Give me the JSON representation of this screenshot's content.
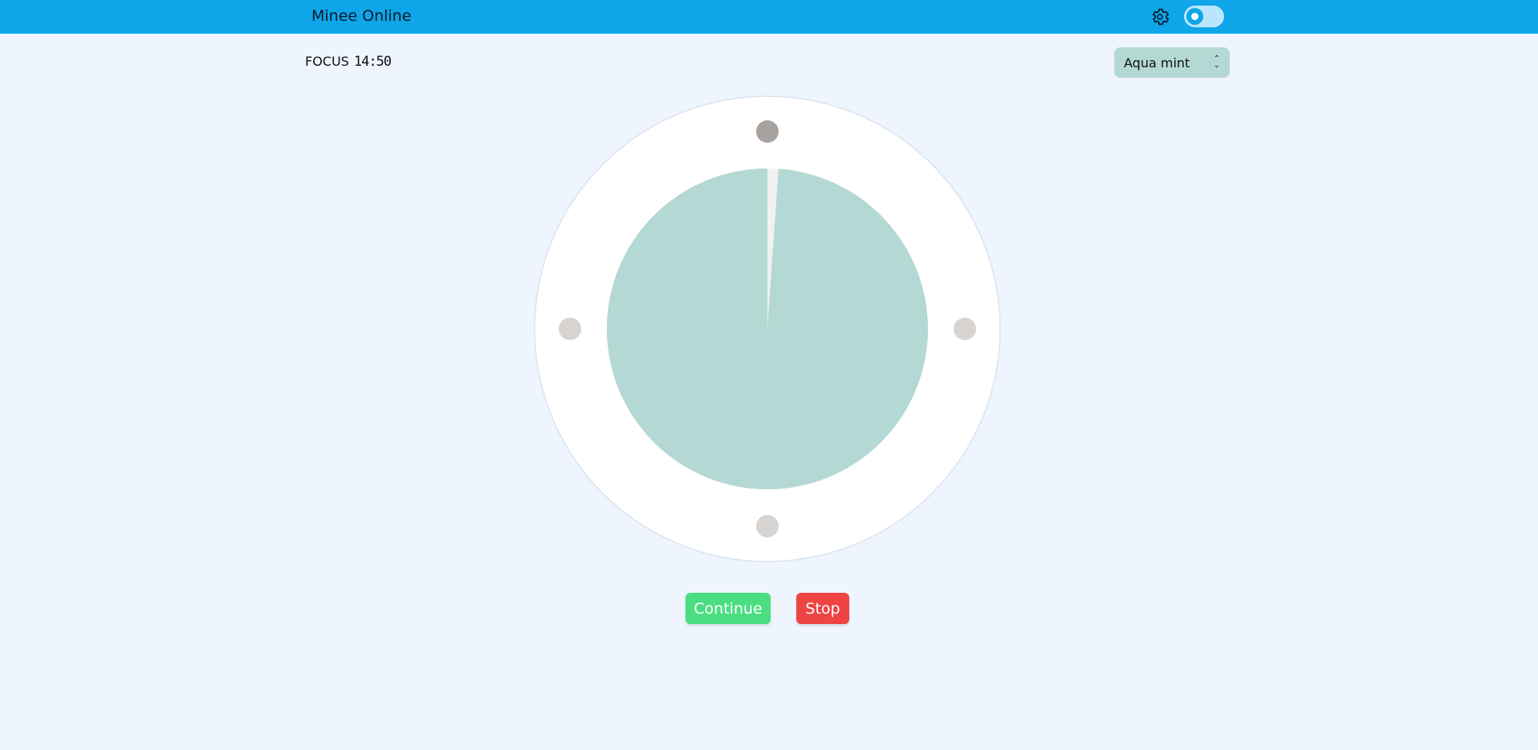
{
  "header": {
    "title": "Minee Online",
    "settings_icon": "gear-icon",
    "theme_toggle_icon": "sun-icon"
  },
  "timer": {
    "mode_label": "FOCUS",
    "remaining": "14:50",
    "remaining_fraction": 0.9889
  },
  "theme_select": {
    "selected": "Aqua mint"
  },
  "controls": {
    "continue_label": "Continue",
    "stop_label": "Stop"
  },
  "colors": {
    "header_bg": "#0ea5e9",
    "page_bg": "#eef5fe",
    "dial_fill": "#b4d8d3",
    "continue": "#4ade80",
    "stop": "#ef4444"
  }
}
